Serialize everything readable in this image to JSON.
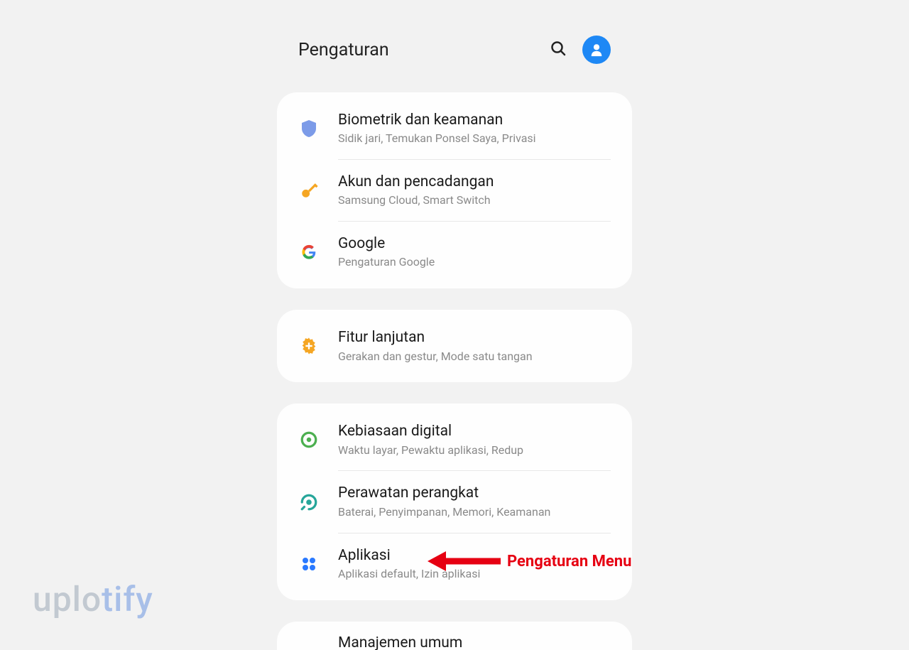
{
  "header": {
    "title": "Pengaturan"
  },
  "groups": [
    {
      "items": [
        {
          "title": "Biometrik dan keamanan",
          "subtitle": "Sidik jari, Temukan Ponsel Saya, Privasi"
        },
        {
          "title": "Akun dan pencadangan",
          "subtitle": "Samsung Cloud, Smart Switch"
        },
        {
          "title": "Google",
          "subtitle": "Pengaturan Google"
        }
      ]
    },
    {
      "items": [
        {
          "title": "Fitur lanjutan",
          "subtitle": "Gerakan dan gestur, Mode satu tangan"
        }
      ]
    },
    {
      "items": [
        {
          "title": "Kebiasaan digital",
          "subtitle": "Waktu layar, Pewaktu aplikasi, Redup"
        },
        {
          "title": "Perawatan perangkat",
          "subtitle": "Baterai, Penyimpanan, Memori, Keamanan"
        },
        {
          "title": "Aplikasi",
          "subtitle": "Aplikasi default, Izin aplikasi"
        }
      ]
    }
  ],
  "partial": {
    "title": "Manajemen umum"
  },
  "annotation": {
    "label": "Pengaturan Menu"
  },
  "watermark": {
    "part1": "uplo",
    "part2": "tify"
  }
}
